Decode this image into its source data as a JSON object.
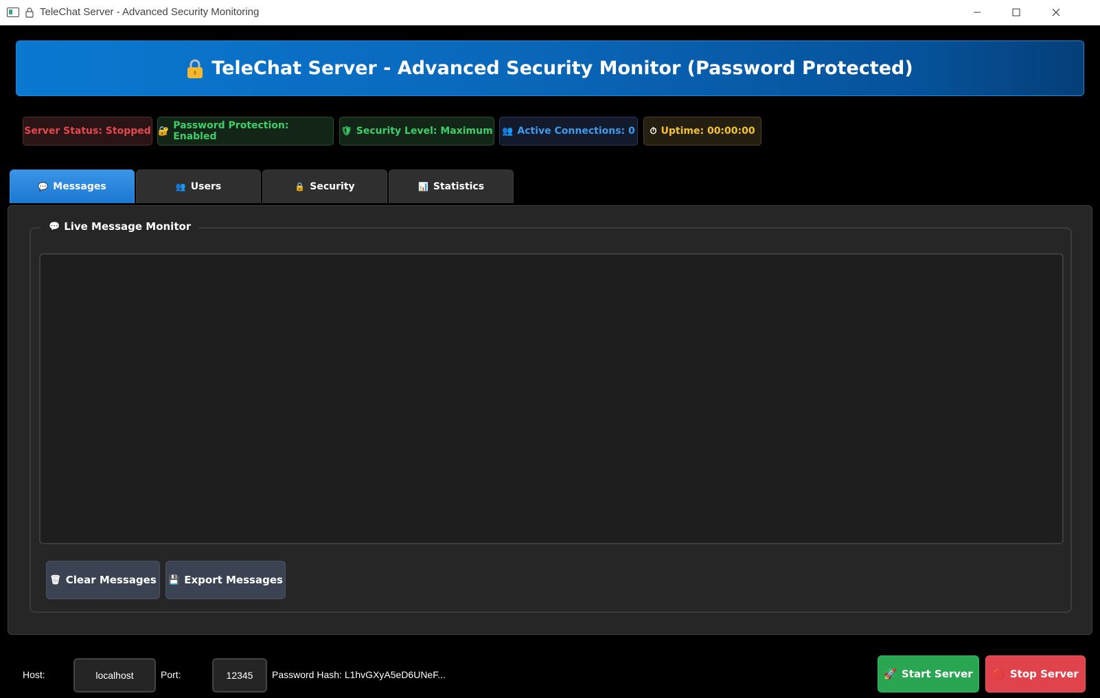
{
  "window": {
    "title": "TeleChat Server - Advanced Security Monitoring",
    "minimize": "—",
    "maximize": "☐",
    "close": "✕"
  },
  "header": {
    "title": "TeleChat Server - Advanced Security Monitor (Password Protected)"
  },
  "status": {
    "server": "Server Status: Stopped",
    "password": "Password Protection: Enabled",
    "security": "Security Level: Maximum",
    "connections": "Active Connections: 0",
    "uptime": "Uptime: 00:00:00",
    "colors": {
      "server": "#e5484d",
      "password": "#3ecf6a",
      "security": "#3ecf6a",
      "connections": "#3b9cf0",
      "uptime": "#f4c430"
    }
  },
  "tabs": [
    {
      "label": "Messages",
      "icon": "speech-bubble-icon",
      "active": true
    },
    {
      "label": "Users",
      "icon": "users-icon",
      "active": false
    },
    {
      "label": "Security",
      "icon": "lock-icon",
      "active": false
    },
    {
      "label": "Statistics",
      "icon": "chart-icon",
      "active": false
    }
  ],
  "messages": {
    "group_title": "Live Message Monitor",
    "content": "",
    "clear_label": "Clear Messages",
    "export_label": "Export Messages"
  },
  "footer": {
    "host_label": "Host:",
    "host_value": "localhost",
    "port_label": "Port:",
    "port_value": "12345",
    "password_hash": "Password Hash: L1hvGXyA5eD6UNeF...",
    "start_label": "Start Server",
    "stop_label": "Stop Server"
  }
}
